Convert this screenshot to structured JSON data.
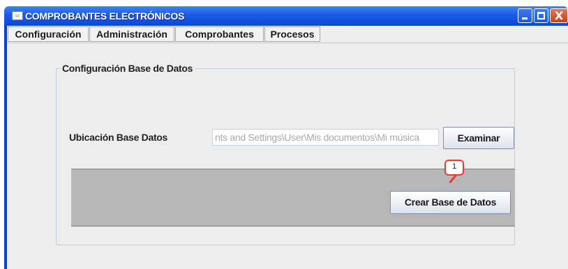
{
  "window": {
    "title": "COMPROBANTES ELECTRÓNICOS",
    "icon": "app-icon",
    "controls": {
      "minimize": "minimize-icon",
      "maximize": "maximize-icon",
      "close_glyph": "X"
    }
  },
  "menu": {
    "items": [
      {
        "label": "Configuración"
      },
      {
        "label": "Administración"
      },
      {
        "label": "Comprobantes"
      },
      {
        "label": "Procesos"
      }
    ]
  },
  "panel": {
    "title": "Configuración Base de Datos",
    "location_label": "Ubicación Base Datos",
    "path_value": "nts and Settings\\User\\Mis documentos\\Mi música",
    "browse_button": "Examinar",
    "create_button": "Crear Base de Datos",
    "callout_number": "1"
  },
  "colors": {
    "titlebar": "#0b47d8",
    "callout": "#ee3a2e",
    "action_area": "#b7b7b7"
  }
}
